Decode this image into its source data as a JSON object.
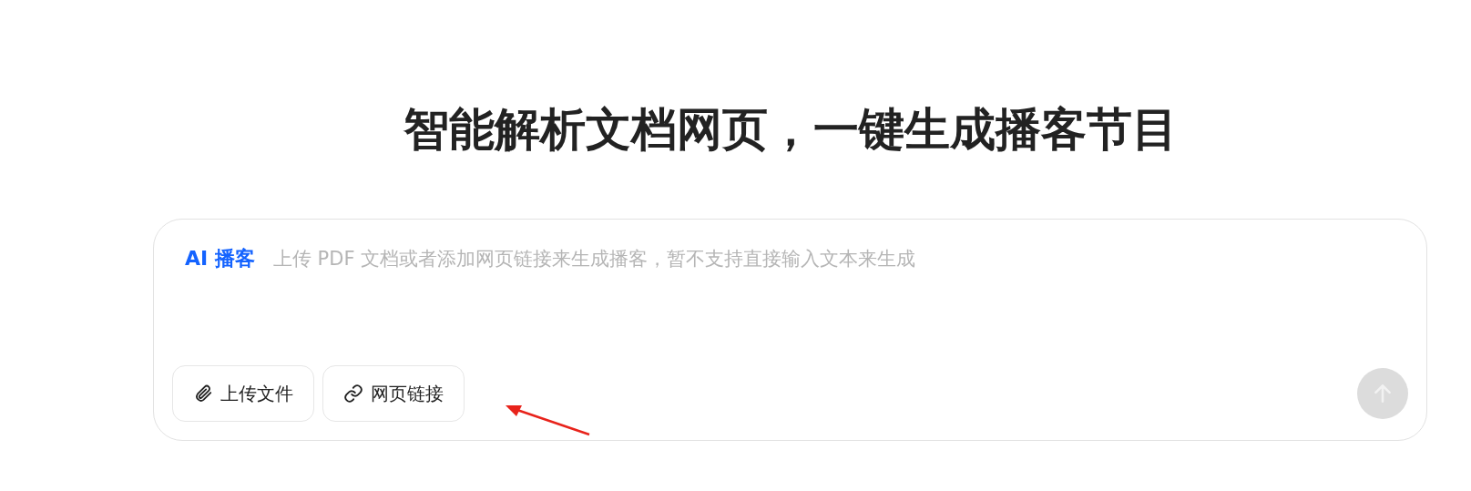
{
  "heading": "智能解析文档网页，一键生成播客节目",
  "composer": {
    "label": "AI 播客",
    "placeholder": "上传 PDF 文档或者添加网页链接来生成播客，暂不支持直接输入文本来生成",
    "actions": [
      {
        "kind": "upload",
        "label": "上传文件"
      },
      {
        "kind": "link",
        "label": "网页链接"
      }
    ],
    "send": {
      "disabled": true
    }
  },
  "annotation": {
    "kind": "arrow"
  }
}
